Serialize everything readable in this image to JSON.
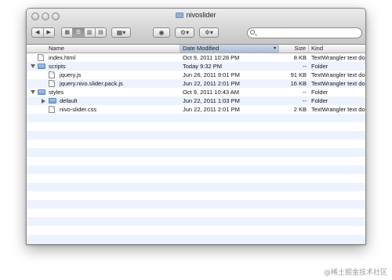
{
  "window": {
    "title": "nivoslider"
  },
  "toolbar": {
    "back_icon": "chevron-left-icon",
    "forward_icon": "chevron-right-icon",
    "view_icons": [
      "icon-view-icon",
      "list-view-icon",
      "column-view-icon",
      "coverflow-view-icon"
    ],
    "arrange_icon": "arrange-icon",
    "quicklook_icon": "eye-icon",
    "share_icon": "share-icon",
    "action_icon": "gear-icon",
    "search_value": ""
  },
  "columns": {
    "name": "Name",
    "date": "Date Modified",
    "size": "Size",
    "kind": "Kind"
  },
  "files": [
    {
      "name": "index.html",
      "date": "Oct 9, 2011 10:28 PM",
      "size": "8 KB",
      "kind": "TextWrangler text doc",
      "type": "file",
      "indent": 0,
      "disclosure": ""
    },
    {
      "name": "scripts",
      "date": "Today 9:32 PM",
      "size": "--",
      "kind": "Folder",
      "type": "folder",
      "indent": 0,
      "disclosure": "open"
    },
    {
      "name": "jquery.js",
      "date": "Jun 26, 2011 9:01 PM",
      "size": "91 KB",
      "kind": "TextWrangler text doc",
      "type": "file",
      "indent": 1,
      "disclosure": ""
    },
    {
      "name": "jquery.nivo.slider.pack.js",
      "date": "Jun 22, 2011 2:01 PM",
      "size": "16 KB",
      "kind": "TextWrangler text doc",
      "type": "file",
      "indent": 1,
      "disclosure": ""
    },
    {
      "name": "styles",
      "date": "Oct 9, 2011 10:43 AM",
      "size": "--",
      "kind": "Folder",
      "type": "folder",
      "indent": 0,
      "disclosure": "open"
    },
    {
      "name": "default",
      "date": "Jun 22, 2011 1:03 PM",
      "size": "--",
      "kind": "Folder",
      "type": "folder",
      "indent": 1,
      "disclosure": "closed"
    },
    {
      "name": "nivo-slider.css",
      "date": "Jun 22, 2011 2:01 PM",
      "size": "2 KB",
      "kind": "TextWrangler text doc",
      "type": "file",
      "indent": 1,
      "disclosure": ""
    }
  ],
  "watermark": "@稀土掘金技术社区"
}
